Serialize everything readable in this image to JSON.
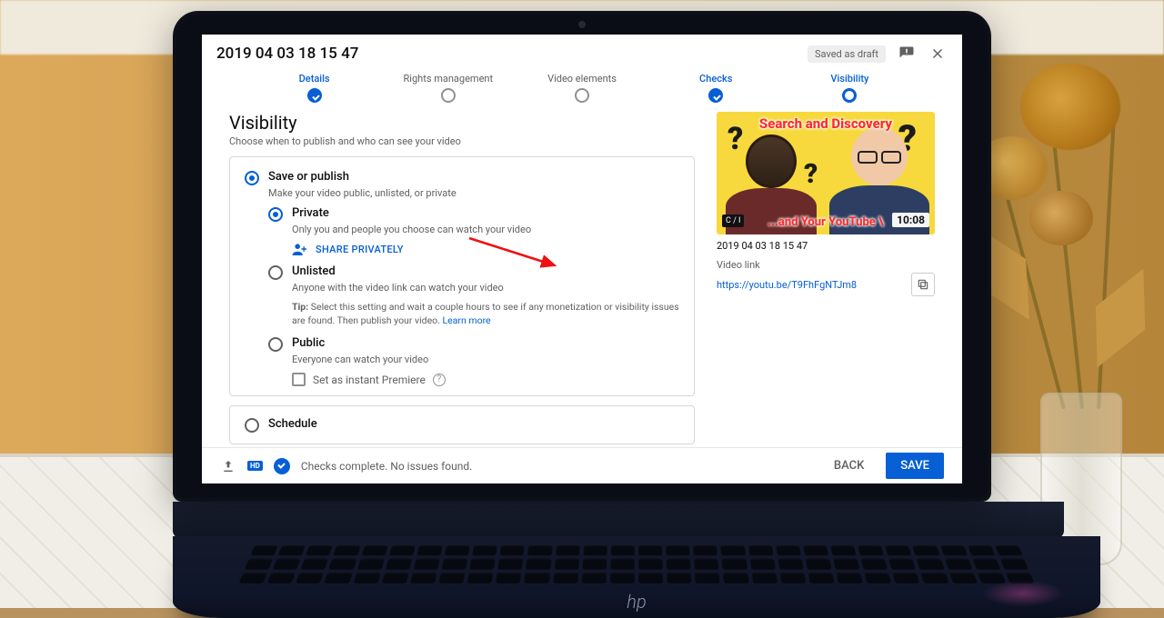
{
  "header": {
    "title": "2019 04 03 18 15 47",
    "status_chip": "Saved as draft",
    "feedback_icon": "feedback-icon",
    "close_icon": "close-icon"
  },
  "stepper": {
    "steps": [
      {
        "label": "Details",
        "state": "active"
      },
      {
        "label": "Rights management",
        "state": ""
      },
      {
        "label": "Video elements",
        "state": ""
      },
      {
        "label": "Checks",
        "state": "active"
      },
      {
        "label": "Visibility",
        "state": "current"
      }
    ]
  },
  "section": {
    "heading": "Visibility",
    "sub": "Choose when to publish and who can see your video"
  },
  "options": {
    "save_publish": {
      "title": "Save or publish",
      "desc": "Make your video public, unlisted, or private"
    },
    "private": {
      "title": "Private",
      "desc": "Only you and people you choose can watch your video",
      "share_btn": "SHARE PRIVATELY"
    },
    "unlisted": {
      "title": "Unlisted",
      "desc": "Anyone with the video link can watch your video",
      "tip_prefix": "Tip: ",
      "tip": "Select this setting and wait a couple hours to see if any monetization or visibility issues are found. Then publish your video. ",
      "learn": "Learn more"
    },
    "public": {
      "title": "Public",
      "desc": "Everyone can watch your video",
      "premiere": "Set as instant Premiere"
    },
    "schedule": {
      "title": "Schedule"
    }
  },
  "preview": {
    "overlay_top": "Search and Discovery",
    "overlay_bottom": "...and Your YouTube \\",
    "badge": "C / I",
    "duration": "10:08",
    "filename": "2019 04 03 18 15 47",
    "link_label": "Video link",
    "link_url": "https://youtu.be/T9FhFgNTJm8"
  },
  "footer": {
    "status": "Checks complete. No issues found.",
    "back": "BACK",
    "save": "SAVE"
  },
  "laptop_brand": "hp"
}
